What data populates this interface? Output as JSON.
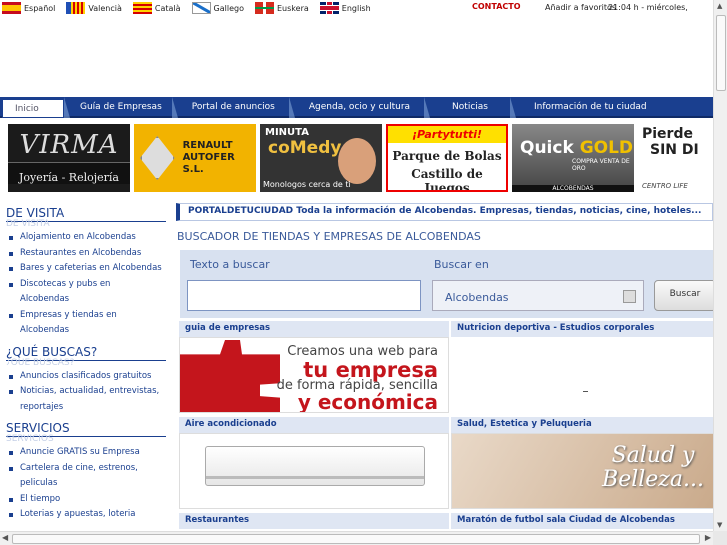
{
  "languages": [
    {
      "label": "Español",
      "flag": "es"
    },
    {
      "label": "Valencià",
      "flag": "va"
    },
    {
      "label": "Català",
      "flag": "ca"
    },
    {
      "label": "Gallego",
      "flag": "ga"
    },
    {
      "label": "Euskera",
      "flag": "eu"
    },
    {
      "label": "English",
      "flag": "en"
    }
  ],
  "top": {
    "contact": "CONTACTO",
    "favorites": "Añadir a favoritos",
    "clock": "21:04 h - miércoles,"
  },
  "nav": [
    "Inicio",
    "Guía de Empresas",
    "Portal de anuncios",
    "Agenda, ocio y cultura",
    "Noticias",
    "Información de tu ciudad"
  ],
  "banners": {
    "virma": {
      "name": "VIRMA",
      "sub": "Joyería - Relojería"
    },
    "renault": {
      "line1": "RENAULT",
      "line2": "AUTOFER S.L."
    },
    "comedy": {
      "line1": "MINUTA",
      "line2": "coMedy",
      "line3": "Monologos cerca de ti"
    },
    "partytutti": {
      "line1": "¡Partytutti!",
      "line2": "Parque de Bolas",
      "line3": "Castillo de Juegos"
    },
    "quickgold": {
      "line1": "Quick",
      "line2": "GOLD",
      "line3": "COMPRA VENTA DE ORO",
      "line4": "ALCOBENDAS"
    },
    "pierde": {
      "line1": "Pierde",
      "line2": "SIN DI",
      "line3": "CENTRO LIFE"
    }
  },
  "sidebar": {
    "sections": [
      {
        "title": "DE VISITA",
        "shadow": "DE VISITA",
        "items": [
          "Alojamiento en Alcobendas",
          "Restaurantes en Alcobendas",
          "Bares y cafeterias en Alcobendas",
          "Discotecas y pubs en Alcobendas",
          "Empresas y tiendas en Alcobendas"
        ]
      },
      {
        "title": "¿QUÉ BUSCAS?",
        "shadow": "¿QUÉ BUSCAS?",
        "items": [
          "Anuncios clasificados gratuitos",
          "Noticias, actualidad, entrevistas, reportajes"
        ]
      },
      {
        "title": "SERVICIOS",
        "shadow": "SERVICIOS",
        "items": [
          "Anuncie GRATIS su Empresa",
          "Cartelera de cine, estrenos, peliculas",
          "El tiempo",
          "Loterias y apuestas, loteria"
        ]
      }
    ]
  },
  "main": {
    "headline": "PORTALDETUCIUDAD Toda la información de Alcobendas. Empresas, tiendas, noticias, cine, hoteles...",
    "search_title": "BUSCADOR DE TIENDAS Y EMPRESAS DE ALCOBENDAS",
    "search_label": "Texto a buscar",
    "search_in_label": "Buscar en",
    "search_value": "",
    "city_selected": "Alcobendas",
    "search_button": "Buscar",
    "cards": [
      {
        "title": "guia de empresas"
      },
      {
        "title": "Nutricion deportiva - Estudios corporales"
      },
      {
        "title": "Aire acondicionado"
      },
      {
        "title": "Salud, Estetica y Peluqueria"
      },
      {
        "title": "Restaurantes"
      },
      {
        "title": "Maratón de futbol sala Ciudad de Alcobendas"
      }
    ],
    "ad_web": {
      "l1": "Creamos una web para",
      "l2": "tu empresa",
      "l3": "de forma rápida, sencilla",
      "l4": "y económica"
    },
    "ad_salud": {
      "l1": "Salud y",
      "l2": "Belleza..."
    }
  }
}
